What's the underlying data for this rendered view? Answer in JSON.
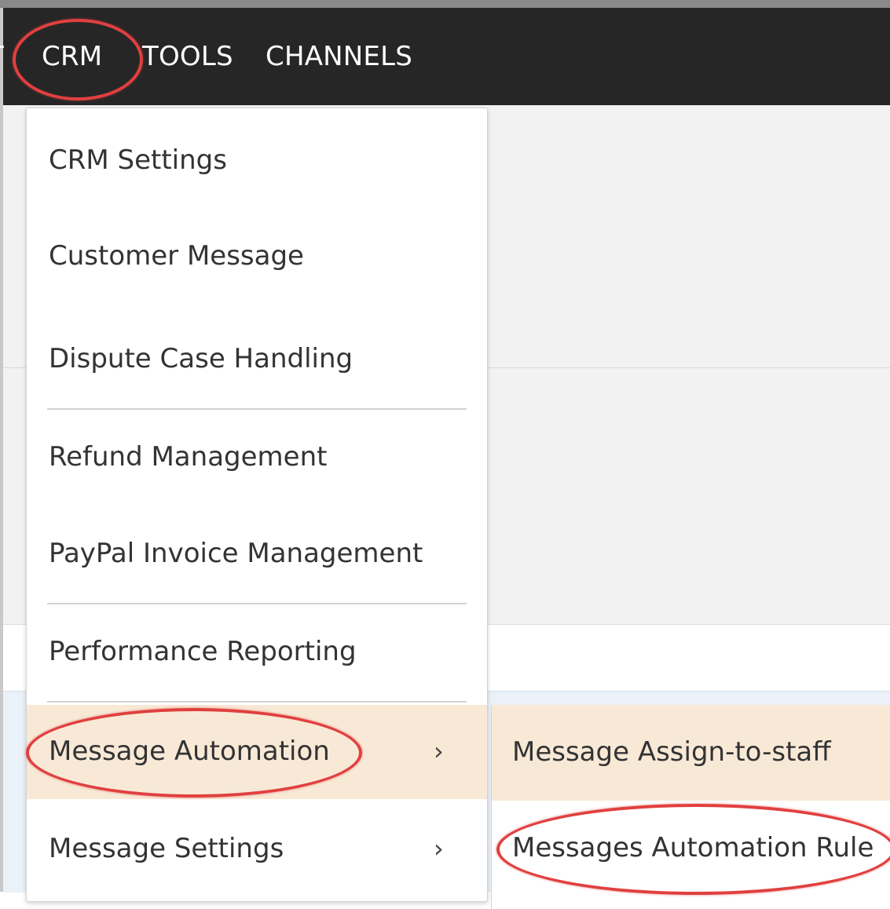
{
  "navbar": {
    "prev_partial": "T",
    "items": [
      {
        "label": "CRM"
      },
      {
        "label": "TOOLS"
      },
      {
        "label": "CHANNELS"
      }
    ]
  },
  "crm_menu": {
    "items": [
      {
        "label": "CRM Settings"
      },
      {
        "label": "Customer Message"
      },
      {
        "label": "Dispute Case Handling"
      },
      {
        "label": "Refund Management"
      },
      {
        "label": "PayPal Invoice Management"
      },
      {
        "label": "Performance Reporting"
      },
      {
        "label": "Message Automation",
        "chevron": "›"
      },
      {
        "label": "Message Settings",
        "chevron": "›"
      }
    ]
  },
  "message_automation_submenu": {
    "items": [
      {
        "label": "Message Assign-to-staff"
      },
      {
        "label": "Messages Automation Rule"
      }
    ]
  },
  "colors": {
    "navbar_bg": "#262626",
    "highlight_bg": "#f8e9d7",
    "annotation_red": "#e0403f"
  },
  "icons": {
    "submenu_indicator": "chevron-right-icon"
  }
}
